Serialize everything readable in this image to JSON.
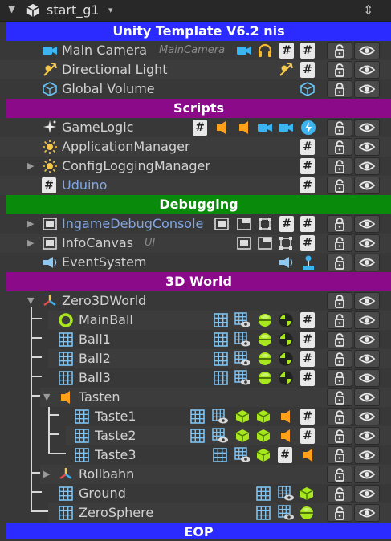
{
  "toolbar": {
    "scene_name": "start_g1",
    "dropdown": "▾",
    "fold": "▼",
    "sort": "⇕"
  },
  "headers": {
    "unity": {
      "label": "Unity Template V6.2 nis",
      "color": "#2b2bff"
    },
    "scripts": {
      "label": "Scripts",
      "color": "#8a0a8a"
    },
    "debugging": {
      "label": "Debugging",
      "color": "#0a8a0a"
    },
    "world": {
      "label": "3D World",
      "color": "#8a0a8a"
    },
    "eop": {
      "label": "EOP",
      "color": "#2b2bff"
    }
  },
  "objects": {
    "main_camera": {
      "label": "Main Camera",
      "tag": "MainCamera"
    },
    "directional_light": {
      "label": "Directional Light"
    },
    "global_volume": {
      "label": "Global Volume"
    },
    "gamelogic": {
      "label": "GameLogic"
    },
    "application_manager": {
      "label": "ApplicationManager"
    },
    "config_logging_manager": {
      "label": "ConfigLoggingManager"
    },
    "uduino": {
      "label": "Uduino"
    },
    "ingame_debug_console": {
      "label": "IngameDebugConsole"
    },
    "info_canvas": {
      "label": "InfoCanvas",
      "tag": "UI"
    },
    "event_system": {
      "label": "EventSystem"
    },
    "zero3dworld": {
      "label": "Zero3DWorld"
    },
    "mainball": {
      "label": "MainBall"
    },
    "ball1": {
      "label": "Ball1"
    },
    "ball2": {
      "label": "Ball2"
    },
    "ball3": {
      "label": "Ball3"
    },
    "tasten": {
      "label": "Tasten"
    },
    "taste1": {
      "label": "Taste1"
    },
    "taste2": {
      "label": "Taste2"
    },
    "taste3": {
      "label": "Taste3"
    },
    "rollbahn": {
      "label": "Rollbahn"
    },
    "ground": {
      "label": "Ground"
    },
    "zerosphere": {
      "label": "ZeroSphere"
    }
  },
  "glyphs": {
    "script": "#",
    "collapsed": "▶",
    "expanded": "▼"
  },
  "colors": {
    "accent_green": "#a8e61e",
    "audio_orange": "#ffa21a",
    "camera_blue": "#3cb4f0",
    "mesh_blue": "#78c0f0",
    "blue_label": "#7fa7e6"
  }
}
